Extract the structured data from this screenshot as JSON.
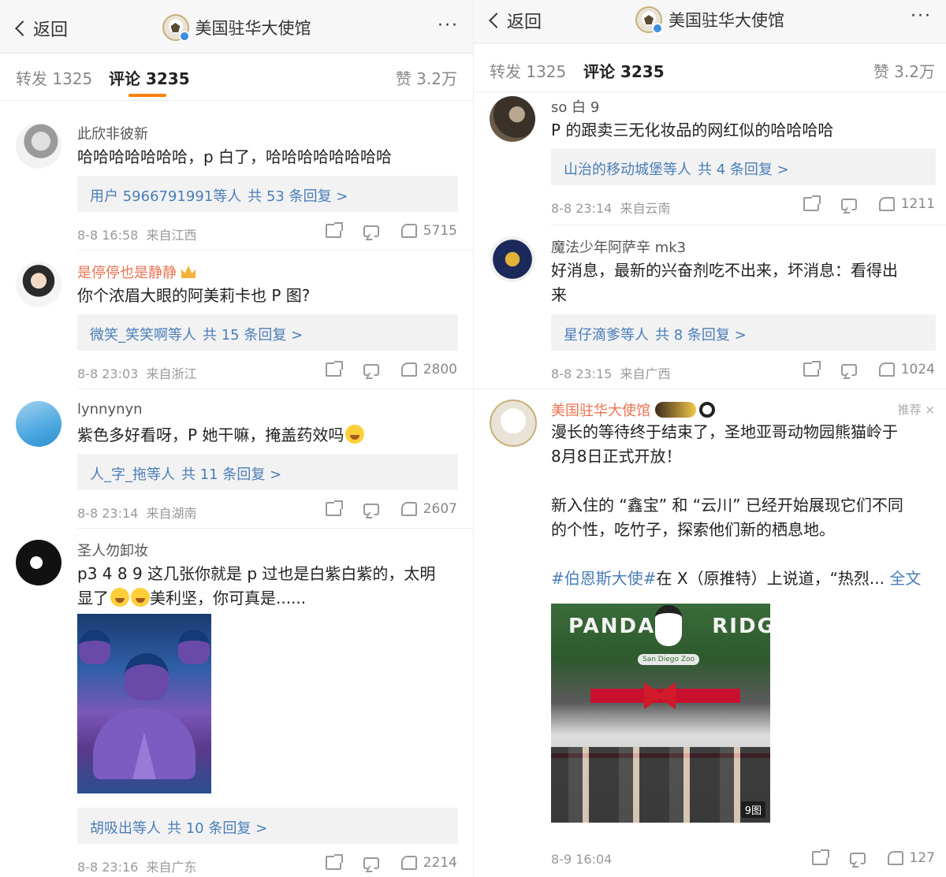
{
  "left": {
    "nav": {
      "back_label": "返回",
      "title": "美国驻华大使馆",
      "more": "···"
    },
    "tabs": {
      "repost": "转发 1325",
      "comments": "评论 3235",
      "likes": "赞 3.2万"
    },
    "comments": [
      {
        "user": "此欣非彼新",
        "text": "哈哈哈哈哈哈哈，p 白了，哈哈哈哈哈哈哈哈",
        "reply_users": "用户 5966791991等人",
        "reply_count": "共 53 条回复 >",
        "time": "8-8 16:58",
        "location": "来自江西",
        "likes": "5715"
      },
      {
        "user": "是停停也是静静",
        "text": "你个浓眉大眼的阿美莉卡也 P 图?",
        "reply_users": "微笑_笑笑啊等人",
        "reply_count": "共 15 条回复 >",
        "time": "8-8 23:03",
        "location": "来自浙江",
        "likes": "2800"
      },
      {
        "user": "lynnynyn",
        "text": "紫色多好看呀，P 她干嘛，掩盖药效吗",
        "reply_users": "人_字_拖等人",
        "reply_count": "共 11 条回复 >",
        "time": "8-8 23:14",
        "location": "来自湖南",
        "likes": "2607"
      },
      {
        "user": "圣人勿卸妆",
        "text_line1": "p3 4 8 9 这几张你就是 p 过也是白紫白紫的，太明",
        "text_line2a": "显了",
        "text_line2b": "美利坚，你可真是......",
        "reply_users": "胡吸出等人",
        "reply_count": "共 10 条回复 >",
        "time": "8-8 23:16",
        "location": "来自广东",
        "likes": "2214"
      }
    ]
  },
  "right": {
    "nav": {
      "back_label": "返回",
      "title": "美国驻华大使馆",
      "more": "···"
    },
    "tabs": {
      "repost": "转发 1325",
      "comments": "评论 3235",
      "likes": "赞 3.2万"
    },
    "comments": [
      {
        "user": "so 白 9",
        "text": "P 的跟卖三无化妆品的网红似的哈哈哈哈",
        "reply_users": "山治的移动城堡等人",
        "reply_count": "共 4 条回复 >",
        "time": "8-8 23:14",
        "location": "来自云南",
        "likes": "1211"
      },
      {
        "user": "魔法少年阿萨辛 mk3",
        "text_line1": "好消息，最新的兴奋剂吃不出来，坏消息：看得出",
        "text_line2": "来",
        "reply_users": "星仔滴爹等人",
        "reply_count": "共 8 条回复 >",
        "time": "8-8 23:15",
        "location": "来自广西",
        "likes": "1024"
      }
    ],
    "post": {
      "user": "美国驻华大使馆",
      "recommend": "推荐",
      "close": "×",
      "line1": "漫长的等待终于结束了，圣地亚哥动物园熊猫岭于",
      "line2": "8月8日正式开放！",
      "line3": "新入住的 “鑫宝” 和 “云川” 已经开始展现它们不同",
      "line4": "的个性，吃竹子，探索他们新的栖息地。",
      "hashtag": "#伯恩斯大使#",
      "line5": "在 X（原推特）上说道，“热烈...",
      "fulltext": "全文",
      "photo_sign_left": "PANDA",
      "photo_sign_right": "RIDGE",
      "photo_sub": "San Diego Zoo",
      "photo_count": "9图",
      "time": "8-9 16:04",
      "likes": "127"
    }
  }
}
